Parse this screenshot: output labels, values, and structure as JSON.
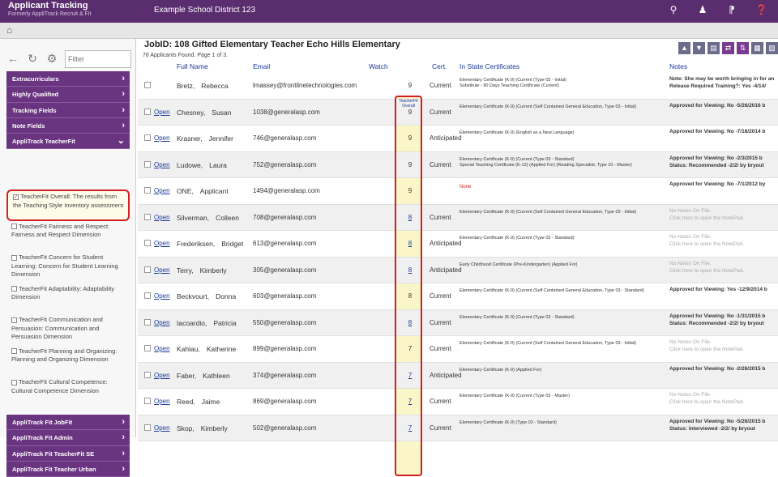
{
  "header": {
    "app_title": "Applicant Tracking",
    "app_subtitle": "Formerly AppliTrack Recruit & Fit",
    "district": "Example School District 123",
    "icons": [
      "search-icon",
      "user-alert-icon",
      "rss-icon",
      "help-icon"
    ]
  },
  "sidebar": {
    "filter_placeholder": "Filter",
    "nav_items": [
      {
        "label": "Extracurriculars"
      },
      {
        "label": "Highly Qualified"
      },
      {
        "label": "Tracking Fields"
      },
      {
        "label": "Note Fields"
      },
      {
        "label": "AppliTrack TeacherFit"
      }
    ],
    "checklist": [
      {
        "label": "TeacherFit Overall: The results from the Teaching Style Inventory assessment",
        "checked": true
      },
      {
        "label": "TeacherFit Fairness and Respect: Fairness and Respect Dimension",
        "checked": false
      },
      {
        "label": "TeacherFit Concern for Student Learning: Concern for Student Learning Dimension",
        "checked": false
      },
      {
        "label": "TeacherFit Adaptability: Adaptability Dimension",
        "checked": false
      },
      {
        "label": "TeacherFit Communication and Persuasion: Communication and Persuasion Dimension",
        "checked": false
      },
      {
        "label": "TeacherFit Planning and Organizing: Planning and Organizing Dimension",
        "checked": false
      },
      {
        "label": "TeacherFit Cultural Competence: Cultural Competence Dimension",
        "checked": false
      }
    ],
    "nav_bottom": [
      {
        "label": "AppliTrack Fit JobFit"
      },
      {
        "label": "AppliTrack Fit Admin"
      },
      {
        "label": "AppliTrack Fit TeacherFit SE"
      },
      {
        "label": "AppliTrack Fit Teacher Urban"
      }
    ]
  },
  "main": {
    "job_title": "JobID: 108   Gifted Elementary Teacher   Echo Hills Elementary",
    "found_text": "78 Applicants Found. Page 1 of 3.",
    "headers": {
      "full_name": "Full Name",
      "email": "Email",
      "watch": "Watch",
      "score": "TeacherFit Overall",
      "cert": "Cert.",
      "state_certs": "In State Certificates",
      "notes": "Notes"
    },
    "rows": [
      {
        "open": "",
        "first": "Bretz,",
        "last": "Rebecca",
        "email": "lmassey@frontlinetechnologies.com",
        "score": "9",
        "score_link": false,
        "cert": "Current",
        "state": [
          "Elementary Certificate (K-9) (Current (Type 03 - Initial)",
          "Substitute - 90 Days Teaching Certificate (Current)"
        ],
        "notes": [
          "Note: She may be worth bringing in for an",
          "Release Required Training?: Yes  -4/14/"
        ]
      },
      {
        "open": "Open",
        "first": "Chesney,",
        "last": "Susan",
        "email": "1038@generalasp.com",
        "score": "9",
        "score_link": false,
        "cert": "Current",
        "state": [
          "Elementary Certificate (K-9) (Current (Self Contained General Education, Type 03 - Initial)"
        ],
        "notes": [
          "Approved for Viewing: No  -5/26/2016 b"
        ]
      },
      {
        "open": "Open",
        "first": "Krasner,",
        "last": "Jennifer",
        "email": "746@generalasp.com",
        "score": "9",
        "score_link": false,
        "cert": "Anticipated",
        "state": [
          "Elementary Certificate (K-9) (English as a New Language)"
        ],
        "notes": [
          "Approved for Viewing: No  -7/16/2014 b"
        ]
      },
      {
        "open": "Open",
        "first": "Ludowe,",
        "last": "Laura",
        "email": "752@generalasp.com",
        "score": "9",
        "score_link": false,
        "cert": "Current",
        "state": [
          "Elementary Certificate (K-9) (Current (Type 03 - Standard)",
          "Special Teaching Certificate (K-12) (Applied For) (Reading Specialist, Type 10 - Master)"
        ],
        "notes": [
          "Approved for Viewing: No  -2/3/2015 b",
          "Status: Recommended  -2/2/ by bryout"
        ]
      },
      {
        "open": "Open",
        "first": "ONE,",
        "last": "Applicant",
        "email": "1494@generalasp.com",
        "score": "9",
        "score_link": false,
        "cert": "",
        "state_none": "None",
        "state": [],
        "notes": [
          "Approved for Viewing: No  -7/1/2012 by"
        ]
      },
      {
        "open": "Open",
        "first": "Silverman,",
        "last": "Colleen",
        "email": "708@generalasp.com",
        "score": "8",
        "score_link": true,
        "cert": "Current",
        "state": [
          "Elementary Certificate (K-9) (Current (Self Contained General Education, Type 03 - Initial)"
        ],
        "notes_empty": true,
        "notes": [
          "No Notes On File.",
          "Click here to open the NotePad."
        ]
      },
      {
        "open": "Open",
        "first": "Frederiksen,",
        "last": "Bridget",
        "email": "613@generalasp.com",
        "score": "8",
        "score_link": true,
        "cert": "Anticipated",
        "state": [
          "Elementary Certificate (K-9) (Current (Type 03 - Standard)"
        ],
        "notes_empty": true,
        "notes": [
          "No Notes On File.",
          "Click here to open the NotePad."
        ]
      },
      {
        "open": "Open",
        "first": "Terry,",
        "last": "Kimberly",
        "email": "305@generalasp.com",
        "score": "8",
        "score_link": true,
        "cert": "Anticipated",
        "state": [
          "Early Childhood Certificate (Pre-Kindergarten) (Applied For)"
        ],
        "notes_empty": true,
        "notes": [
          "No Notes On File.",
          "Click here to open the NotePad."
        ]
      },
      {
        "open": "Open",
        "first": "Beckvourt,",
        "last": "Donna",
        "email": "603@generalasp.com",
        "score": "8",
        "score_link": false,
        "cert": "Current",
        "state": [
          "Elementary Certificate (K-9) (Current (Self Contained General Education, Type 03 - Standard)"
        ],
        "notes": [
          "Approved for Viewing: Yes  -12/9/2014 b"
        ]
      },
      {
        "open": "Open",
        "first": "Iacoardio,",
        "last": "Patricia",
        "email": "550@generalasp.com",
        "score": "8",
        "score_link": true,
        "cert": "Current",
        "state": [
          "Elementary Certificate (K-9) (Current (Type 03 - Standard)"
        ],
        "notes": [
          "Approved for Viewing: No  -1/31/2015 b",
          "Status: Recommended  -2/2/ by bryout"
        ]
      },
      {
        "open": "Open",
        "first": "Kahlau,",
        "last": "Katherine",
        "email": "899@generalasp.com",
        "score": "7",
        "score_link": false,
        "cert": "Current",
        "state": [
          "Elementary Certificate (K-9) (Current (Self Contained General Education, Type 03 - Initial)"
        ],
        "notes_empty": true,
        "notes": [
          "No Notes On File.",
          "Click here to open the NotePad."
        ]
      },
      {
        "open": "Open",
        "first": "Faber,",
        "last": "Kathleen",
        "email": "374@generalasp.com",
        "score": "7",
        "score_link": true,
        "cert": "Anticipated",
        "state": [
          "Elementary Certificate (K-9) (Applied For)"
        ],
        "notes": [
          "Approved for Viewing: No  -2/26/2015 b"
        ]
      },
      {
        "open": "Open",
        "first": "Reed,",
        "last": "Jaime",
        "email": "869@generalasp.com",
        "score": "7",
        "score_link": true,
        "cert": "Current",
        "state": [
          "Elementary Certificate (K-9) (Current (Type 03 - Master)"
        ],
        "notes_empty": true,
        "notes": [
          "No Notes On File.",
          "Click here to open the NotePad."
        ]
      },
      {
        "open": "Open",
        "first": "Skop,",
        "last": "Kimberly",
        "email": "502@generalasp.com",
        "score": "7",
        "score_link": true,
        "cert": "Current",
        "state": [
          "Elementary Certificate (K-9) (Type 03 - Standard)"
        ],
        "notes": [
          "Approved for Viewing: No  -5/26/2015 b",
          "Status: Interviewed  -2/2/ by bryout"
        ]
      }
    ]
  }
}
